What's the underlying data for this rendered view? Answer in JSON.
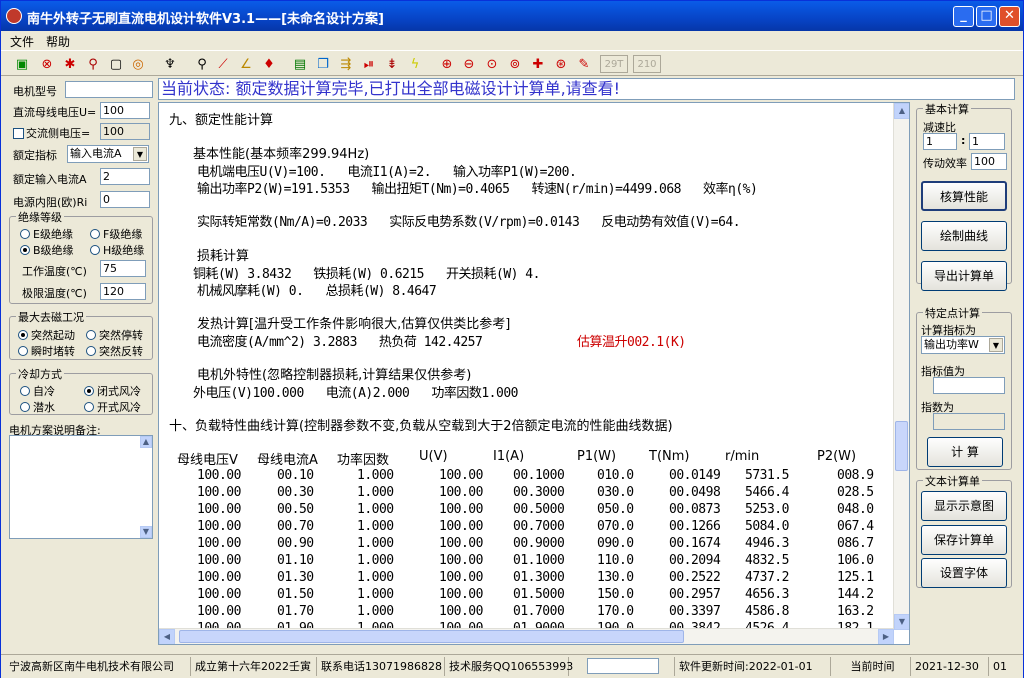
{
  "window": {
    "title": "南牛外转子无刷直流电机设计软件V3.1——[未命名设计方案]"
  },
  "menu": [
    "文件",
    "帮助"
  ],
  "toolbar": {
    "btn1": "29T",
    "btn2": "210"
  },
  "left": {
    "motor_model_label": "电机型号",
    "motor_model_value": "",
    "dc_bus_label": "直流母线电压U=",
    "dc_bus_value": "100",
    "ac_side_label": "交流侧电压=",
    "ac_side_value": "100",
    "rated_label": "额定指标",
    "rated_value": "输入电流A",
    "rated_input_label": "额定输入电流A",
    "rated_input_value": "2",
    "source_r_label": "电源内阻(欧)Ri",
    "source_r_value": "0",
    "insulation": {
      "title": "绝缘等级",
      "b": "E级绝缘",
      "f": "F级绝缘",
      "bb": "B级绝缘",
      "h": "H级绝缘",
      "work_temp_label": "工作温度(℃)",
      "work_temp_value": "75",
      "limit_temp_label": "极限温度(℃)",
      "limit_temp_value": "120"
    },
    "demag": {
      "title": "最大去磁工况",
      "a": "突然起动",
      "b": "突然停转",
      "c": "瞬时堵转",
      "d": "突然反转"
    },
    "cooling": {
      "title": "冷却方式",
      "a": "自冷",
      "b": "闭式风冷",
      "c": "潜水",
      "d": "开式风冷"
    },
    "notes_label": "电机方案说明备注:"
  },
  "status": "当前状态: 额定数据计算完毕,已打出全部电磁设计计算单,请查看!",
  "doc": {
    "l1": "九、额定性能计算",
    "l2": "基本性能(基本频率299.94Hz)",
    "l3": "电机端电压U(V)=100.   电流I1(A)=2.   输入功率P1(W)=200.",
    "l4": "输出功率P2(W)=191.5353   输出扭矩T(Nm)=0.4065   转速N(r/min)=4499.068   效率η(%)",
    "l5": "实际转矩常数(Nm/A)=0.2033   实际反电势系数(V/rpm)=0.0143   反电动势有效值(V)=64.",
    "l6": "损耗计算",
    "l7": "铜耗(W) 3.8432   铁损耗(W) 0.6215   开关损耗(W) 4.",
    "l8": "机械风摩耗(W) 0.   总损耗(W) 8.4647",
    "l9": "发热计算[温升受工作条件影响很大,估算仅供类比参考]",
    "l10a": "电流密度(A/mm^2) 3.2883   热负荷 142.4257",
    "l10b": "估算温升002.1(K)",
    "l11": "电机外特性(忽略控制器损耗,计算结果仅供参考)",
    "l12": "外电压(V)100.000   电流(A)2.000   功率因数1.000",
    "l13": "十、负载特性曲线计算(控制器参数不变,负载从空载到大于2倍额定电流的性能曲线数据)",
    "th": [
      "母线电压V",
      "母线电流A",
      "功率因数",
      "U(V)",
      "I1(A)",
      "P1(W)",
      "T(Nm)",
      "r/min",
      "P2(W)"
    ],
    "rows": [
      [
        "100.00",
        "00.10",
        "1.000",
        "100.00",
        "00.1000",
        "010.0",
        "00.0149",
        "5731.5",
        "008.9"
      ],
      [
        "100.00",
        "00.30",
        "1.000",
        "100.00",
        "00.3000",
        "030.0",
        "00.0498",
        "5466.4",
        "028.5"
      ],
      [
        "100.00",
        "00.50",
        "1.000",
        "100.00",
        "00.5000",
        "050.0",
        "00.0873",
        "5253.0",
        "048.0"
      ],
      [
        "100.00",
        "00.70",
        "1.000",
        "100.00",
        "00.7000",
        "070.0",
        "00.1266",
        "5084.0",
        "067.4"
      ],
      [
        "100.00",
        "00.90",
        "1.000",
        "100.00",
        "00.9000",
        "090.0",
        "00.1674",
        "4946.3",
        "086.7"
      ],
      [
        "100.00",
        "01.10",
        "1.000",
        "100.00",
        "01.1000",
        "110.0",
        "00.2094",
        "4832.5",
        "106.0"
      ],
      [
        "100.00",
        "01.30",
        "1.000",
        "100.00",
        "01.3000",
        "130.0",
        "00.2522",
        "4737.2",
        "125.1"
      ],
      [
        "100.00",
        "01.50",
        "1.000",
        "100.00",
        "01.5000",
        "150.0",
        "00.2957",
        "4656.3",
        "144.2"
      ],
      [
        "100.00",
        "01.70",
        "1.000",
        "100.00",
        "01.7000",
        "170.0",
        "00.3397",
        "4586.8",
        "163.2"
      ],
      [
        "100.00",
        "01.90",
        "1.000",
        "100.00",
        "01.9000",
        "190.0",
        "00.3842",
        "4526.4",
        "182.1"
      ]
    ]
  },
  "right": {
    "basic_title": "基本计算",
    "reduction_label": "减速比",
    "reduction_a": "1",
    "reduction_b": "1",
    "trans_eff_label": "传动效率",
    "trans_eff_value": "100",
    "btn_check": "核算性能",
    "btn_plot": "绘制曲线",
    "btn_export": "导出计算单",
    "special_title": "特定点计算",
    "calc_index_label": "计算指标为",
    "calc_index_value": "输出功率W",
    "index_value_label": "指标值为",
    "index_value": "",
    "exponent_label": "指数为",
    "exponent_value": "",
    "btn_calc": "计 算",
    "text_title": "文本计算单",
    "btn_show": "显示示意图",
    "btn_save": "保存计算单",
    "btn_font": "设置字体"
  },
  "statusbar": {
    "company": "宁波高新区南牛电机技术有限公司",
    "founded": "成立第十六年2022壬寅",
    "phone": "联系电话13071986828",
    "support": "技术服务QQ106553993",
    "box": "",
    "update": "软件更新时间:2022-01-01",
    "now_label": "当前时间",
    "date": "2021-12-30",
    "extra": "01"
  }
}
